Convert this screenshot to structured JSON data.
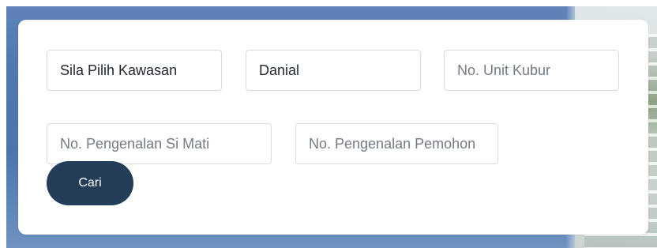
{
  "form": {
    "area_select": {
      "value": "Sila Pilih Kawasan"
    },
    "name_input": {
      "value": "Danial"
    },
    "grave_unit_input": {
      "placeholder": "No. Unit Kubur"
    },
    "deceased_id_input": {
      "placeholder": "No. Pengenalan Si Mati"
    },
    "applicant_id_input": {
      "placeholder": "No. Pengenalan Pemohon"
    },
    "search_button": {
      "label": "Cari"
    }
  },
  "colors": {
    "button_bg": "#243e59",
    "button_text": "#ffffff",
    "card_bg": "#ffffff",
    "input_border": "#d9dde3",
    "placeholder_text": "#737a84",
    "value_text": "#1f2630"
  }
}
